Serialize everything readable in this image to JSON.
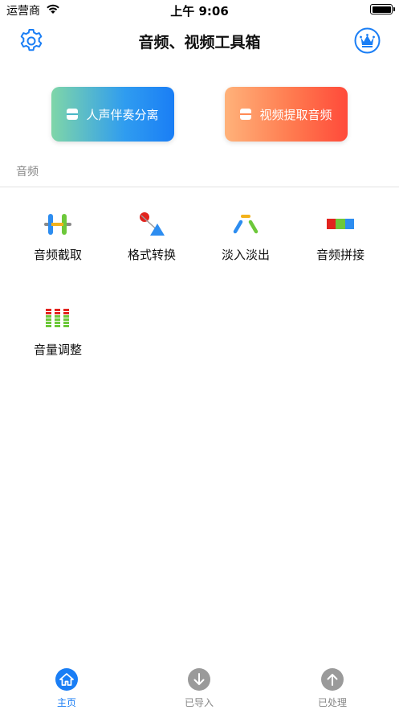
{
  "status_bar": {
    "carrier": "运营商",
    "time": "上午 9:06"
  },
  "header": {
    "title": "音频、视频工具箱",
    "settings_icon": "gear-icon",
    "vip_icon": "crown-icon"
  },
  "features": [
    {
      "label": "人声伴奏分离",
      "icon": "vocal-separation-icon"
    },
    {
      "label": "视频提取音频",
      "icon": "video-extract-icon"
    }
  ],
  "section": {
    "label": "音频"
  },
  "tools": [
    {
      "label": "音频截取",
      "icon": "audio-cut-icon"
    },
    {
      "label": "格式转换",
      "icon": "format-convert-icon"
    },
    {
      "label": "淡入淡出",
      "icon": "fade-icon"
    },
    {
      "label": "音频拼接",
      "icon": "audio-merge-icon"
    },
    {
      "label": "音量调整",
      "icon": "volume-adjust-icon"
    }
  ],
  "tab_bar": [
    {
      "label": "主页",
      "icon": "home-icon"
    },
    {
      "label": "已导入",
      "icon": "download-arrow-icon"
    },
    {
      "label": "已处理",
      "icon": "upload-arrow-icon"
    }
  ],
  "colors": {
    "accent": "#1a7ef5",
    "tab_inactive": "#9a9a9a"
  }
}
